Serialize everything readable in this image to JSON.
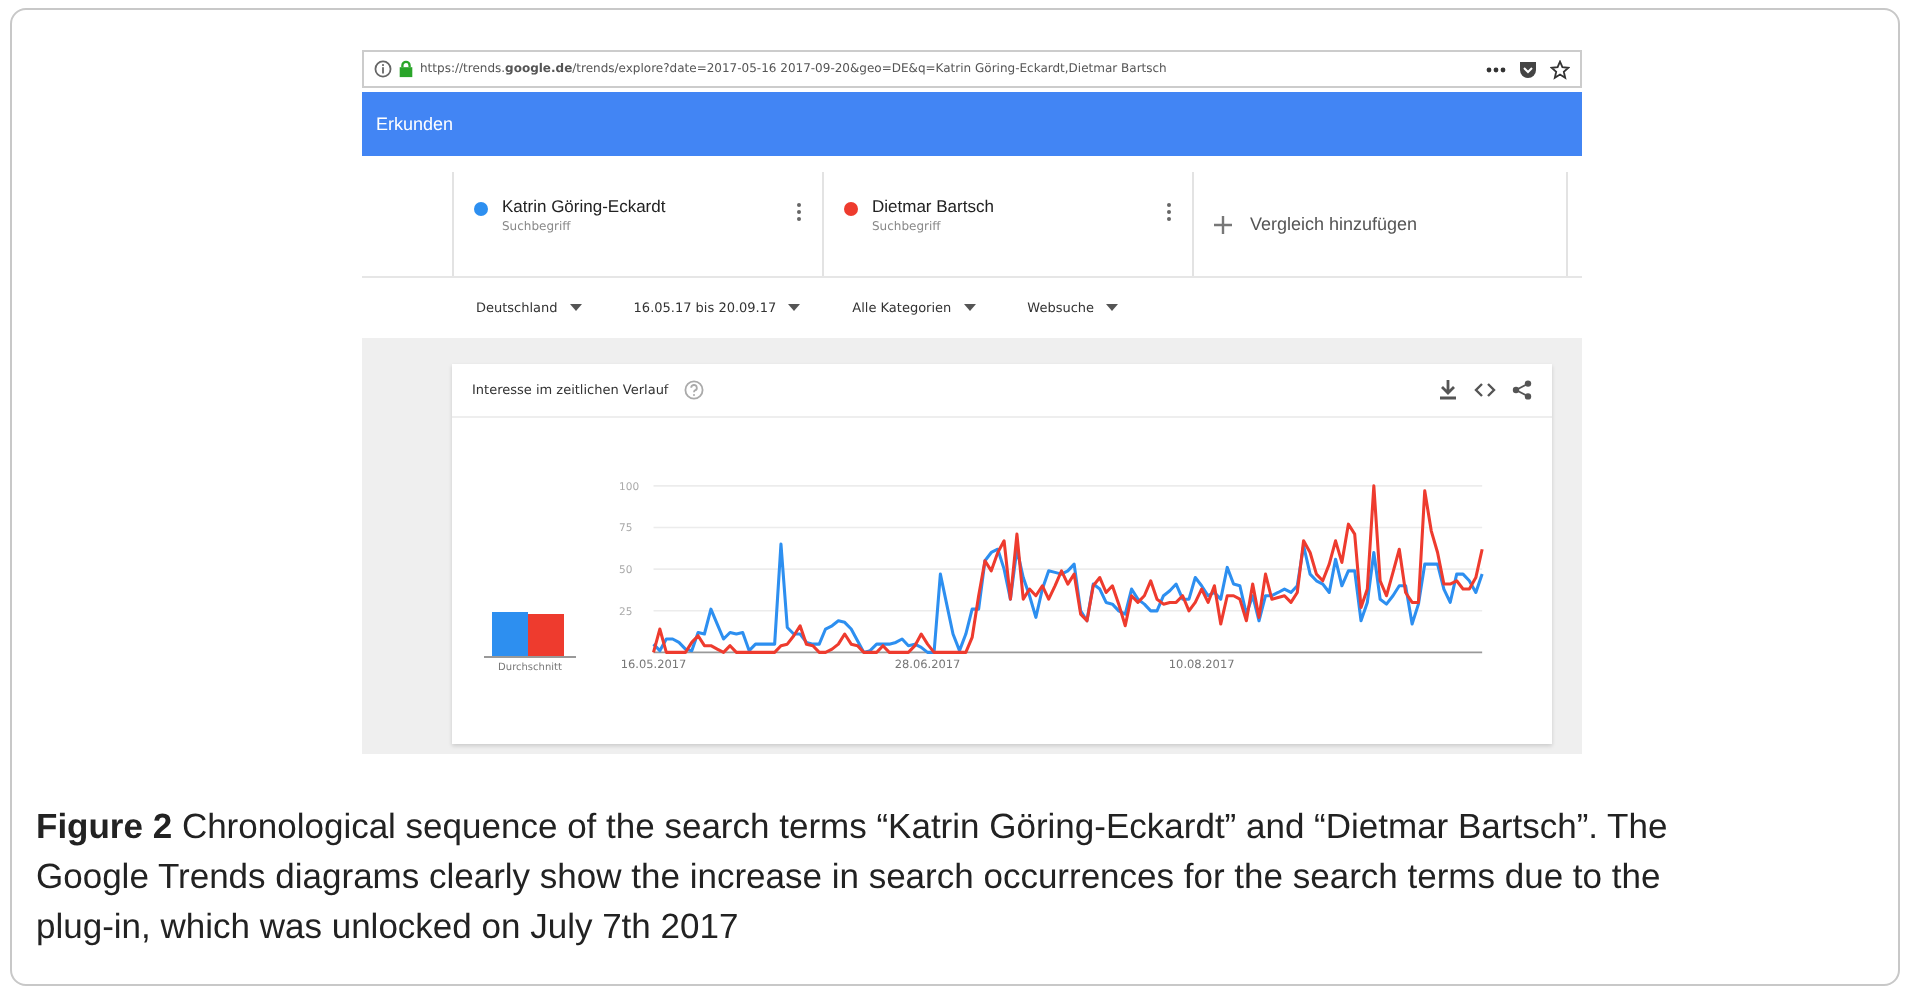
{
  "browser": {
    "url": "https://trends.**google.de**/trends/explore?date=2017-05-16 2017-09-20&geo=DE&q=Katrin Göring-Eckardt,Dietmar Bartsch"
  },
  "header": {
    "title": "Erkunden"
  },
  "terms": [
    {
      "name": "Katrin Göring-Eckardt",
      "type": "Suchbegriff",
      "color": "#2d8ff0"
    },
    {
      "name": "Dietmar Bartsch",
      "type": "Suchbegriff",
      "color": "#ee3b2e"
    }
  ],
  "add_comparison": {
    "label": "Vergleich hinzufügen"
  },
  "filters": [
    "Deutschland",
    "16.05.17 bis 20.09.17",
    "Alle Kategorien",
    "Websuche"
  ],
  "card": {
    "title": "Interesse im zeitlichen Verlauf",
    "average_label": "Durchschnitt",
    "chart_data": {
      "type": "line",
      "categories": [
        "16.05.2017",
        null,
        null,
        null,
        null,
        null,
        null,
        null,
        null,
        null,
        null,
        null,
        null,
        null,
        null,
        null,
        null,
        null,
        null,
        null,
        null,
        null,
        null,
        null,
        null,
        null,
        null,
        null,
        null,
        null,
        null,
        null,
        null,
        null,
        null,
        null,
        null,
        null,
        null,
        null,
        null,
        null,
        null,
        "28.06.2017",
        null,
        null,
        null,
        null,
        null,
        null,
        null,
        null,
        null,
        null,
        null,
        null,
        null,
        null,
        null,
        null,
        null,
        null,
        null,
        null,
        null,
        null,
        null,
        null,
        null,
        null,
        null,
        null,
        null,
        null,
        null,
        null,
        null,
        null,
        null,
        null,
        null,
        null,
        null,
        null,
        null,
        null,
        "10.08.2017",
        null,
        null,
        null,
        null,
        null,
        null,
        null,
        null,
        null,
        null,
        null,
        null,
        null,
        null,
        null,
        null,
        null,
        null,
        null,
        null,
        null,
        null,
        null,
        null,
        null,
        null,
        null,
        null,
        null,
        null,
        null,
        null,
        null,
        null,
        null,
        null,
        null,
        null,
        null,
        null,
        null,
        null,
        null,
        null
      ],
      "yticks": [
        25,
        50,
        75,
        100
      ],
      "ylim": [
        0,
        100
      ],
      "grid": true,
      "series": [
        {
          "color": "#2d8ff0",
          "values": [
            5,
            1,
            8,
            8,
            6,
            2,
            1,
            12,
            11,
            26,
            17,
            8,
            12,
            11,
            12,
            1,
            5,
            5,
            5,
            5,
            65,
            15,
            11,
            11,
            6,
            5,
            5,
            14,
            16,
            19,
            18,
            14,
            7,
            0,
            1,
            5,
            5,
            5,
            6,
            8,
            4,
            5,
            3,
            0,
            0,
            47,
            29,
            11,
            1,
            11,
            26,
            26,
            55,
            60,
            62,
            50,
            32,
            62,
            45,
            34,
            21,
            38,
            49,
            48,
            47,
            49,
            53,
            25,
            19,
            41,
            38,
            30,
            29,
            25,
            23,
            38,
            32,
            29,
            25,
            25,
            34,
            37,
            41,
            32,
            32,
            45,
            40,
            34,
            36,
            32,
            51,
            41,
            40,
            23,
            34,
            19,
            34,
            34,
            36,
            38,
            36,
            40,
            64,
            47,
            43,
            41,
            36,
            56,
            40,
            49,
            49,
            19,
            30,
            60,
            32,
            29,
            34,
            40,
            40,
            17,
            29,
            53,
            53,
            53,
            38,
            30,
            47,
            47,
            43,
            36,
            47
          ]
        },
        {
          "color": "#ee3b2e",
          "values": [
            0,
            14,
            0,
            0,
            0,
            0,
            6,
            10,
            4,
            4,
            2,
            0,
            4,
            0,
            0,
            0,
            0,
            0,
            0,
            0,
            4,
            5,
            10,
            16,
            5,
            4,
            0,
            0,
            2,
            5,
            11,
            5,
            4,
            0,
            0,
            0,
            4,
            0,
            0,
            0,
            0,
            4,
            11,
            5,
            0,
            0,
            0,
            0,
            0,
            0,
            9,
            34,
            55,
            49,
            60,
            67,
            32,
            71,
            32,
            38,
            34,
            40,
            32,
            40,
            49,
            41,
            47,
            23,
            19,
            40,
            45,
            36,
            40,
            29,
            16,
            34,
            30,
            34,
            43,
            32,
            29,
            30,
            30,
            34,
            25,
            30,
            38,
            30,
            40,
            17,
            34,
            34,
            32,
            19,
            41,
            21,
            47,
            32,
            33,
            34,
            30,
            36,
            67,
            60,
            47,
            43,
            53,
            67,
            54,
            77,
            71,
            27,
            38,
            100,
            43,
            34,
            48,
            62,
            36,
            30,
            30,
            97,
            73,
            60,
            41,
            41,
            43,
            38,
            38,
            45,
            62
          ]
        }
      ]
    }
  },
  "caption": {
    "text": "**Figure 2**  Chronological sequence of the search terms “Katrin Göring-Eckardt” and “Dietmar Bartsch”. The Google Trends diagrams clearly show the increase in search occurrences for the search terms due to the plug-in, which was unlocked on July 7th 2017"
  }
}
